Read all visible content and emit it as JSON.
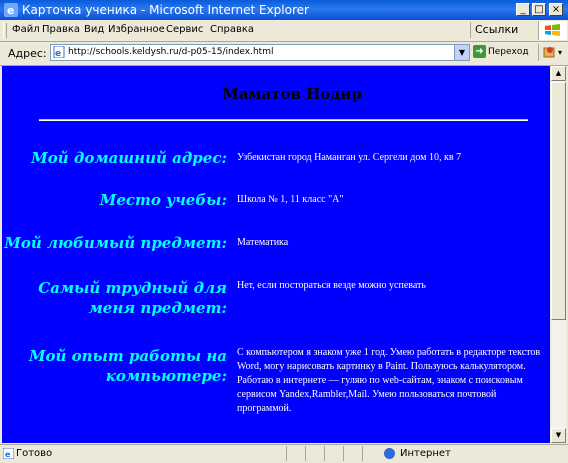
{
  "window": {
    "title": "Карточка ученика - Microsoft Internet Explorer",
    "minimize_label": "_",
    "maximize_label": "□",
    "close_label": "×"
  },
  "menu": {
    "items": [
      "Файл",
      "Правка",
      "Вид",
      "Избранное",
      "Сервис",
      "Справка"
    ],
    "links_label": "Ссылки",
    "links_chevron": "»"
  },
  "address_bar": {
    "label": "Адрес:",
    "url": "http://schools.keldysh.ru/d-p05-15/index.html",
    "go_label": "Переход"
  },
  "page": {
    "student_name": "Маматов Нодир",
    "rows": [
      {
        "label": "Мой домашний адрес:",
        "value": "Узбекистан город Наманган ул. Сергели дом 10, кв 7"
      },
      {
        "label": "Место учебы:",
        "value": "Школа № 1, 11 класс \"А\""
      },
      {
        "label": "Мой любимый предмет:",
        "value": "Математика"
      },
      {
        "label": "Самый трудный для меня предмет:",
        "value": "Нет, если постораться везде можно успевать"
      },
      {
        "label": "Мой опыт работы на компьютере:",
        "value": "С компьютером я знаком уже 1 год. Умею работать в редакторе текстов Word, могу нарисовать картинку в Paint. Пользуюсь калькулятором. Работаю в интернете — гуляю по web-сайтам, знаком с поисковым сервисом Yandex,Rambler,Mail. Умею пользоваться почтовой программой."
      }
    ],
    "background_color": "#0000ff",
    "label_color": "#00ffff"
  },
  "status_bar": {
    "status": "Готово",
    "zone": "Интернет"
  },
  "icons": {
    "titlebar": "ie-logo-icon",
    "address": "page-icon",
    "go": "go-arrow-icon",
    "status": "page-done-icon",
    "zone": "internet-globe-icon"
  }
}
